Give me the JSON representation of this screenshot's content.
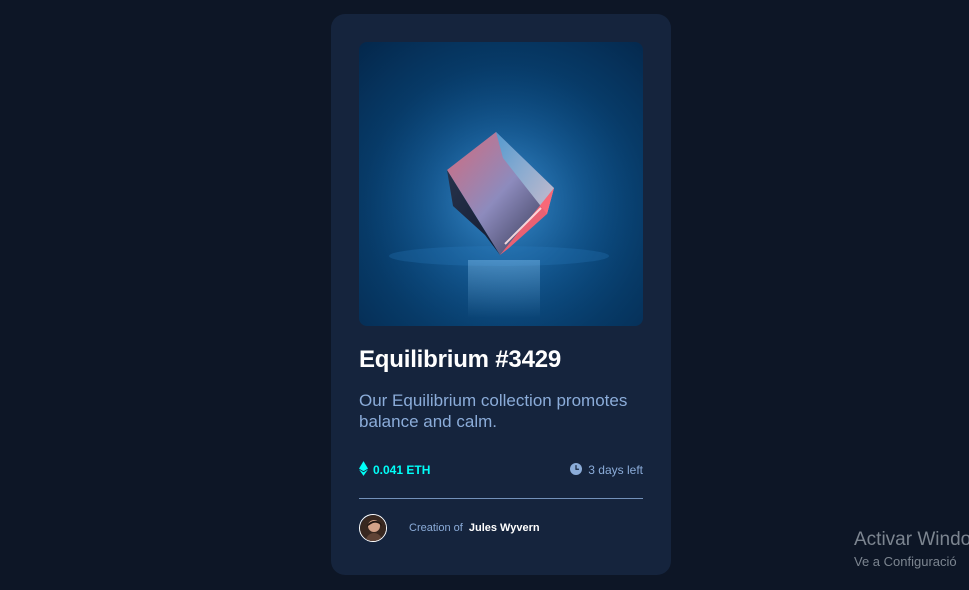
{
  "card": {
    "image_alt": "Equilibrium cube",
    "title": "Equilibrium #3429",
    "description": "Our Equilibrium collection promotes balance and calm.",
    "price": "0.041 ETH",
    "time_left": "3 days left",
    "creator_prefix": "Creation of",
    "creator_name": "Jules Wyvern"
  },
  "icons": {
    "price": "ethereum-icon",
    "time": "clock-icon",
    "avatar": "avatar-image"
  },
  "colors": {
    "page_background": "#0d1626",
    "card_background": "#15243d",
    "accent_cyan": "#00fff8",
    "soft_blue": "#8bacd9",
    "white": "#ffffff"
  },
  "os_overlay": {
    "activation_title": "Activar Windo",
    "activation_subtitle": "Ve a Configuració"
  }
}
